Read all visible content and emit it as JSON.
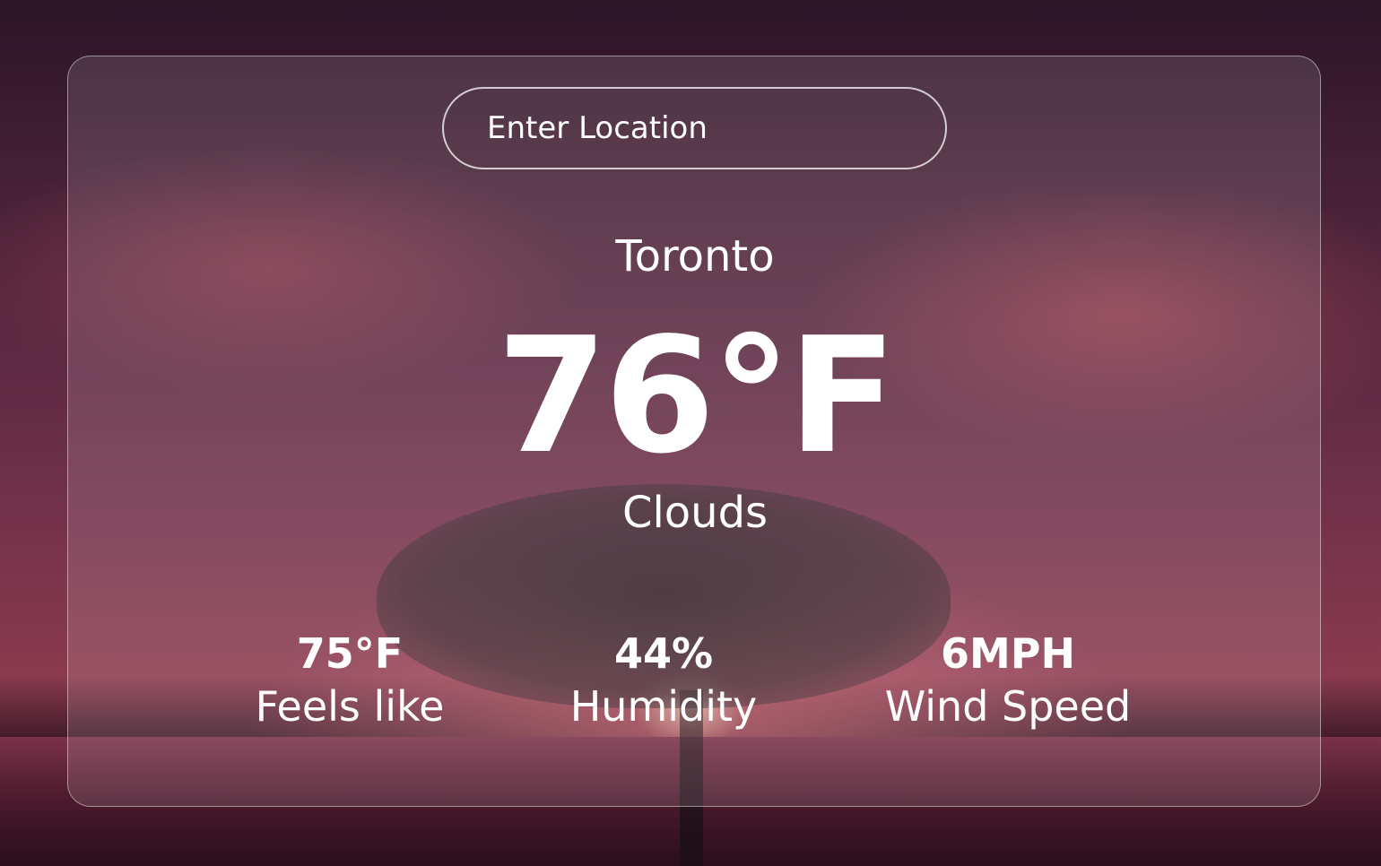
{
  "search": {
    "placeholder": "Enter Location",
    "value": ""
  },
  "weather": {
    "city": "Toronto",
    "temperature": "76°F",
    "condition": "Clouds"
  },
  "details": {
    "feels_like": {
      "value": "75°F",
      "label": "Feels like"
    },
    "humidity": {
      "value": "44%",
      "label": "Humidity"
    },
    "wind_speed": {
      "value": "6MPH",
      "label": "Wind Speed"
    }
  },
  "colors": {
    "text": "#ffffff",
    "card_background": "rgba(255,255,255,0.12)",
    "card_border": "rgba(255,255,255,0.45)"
  }
}
